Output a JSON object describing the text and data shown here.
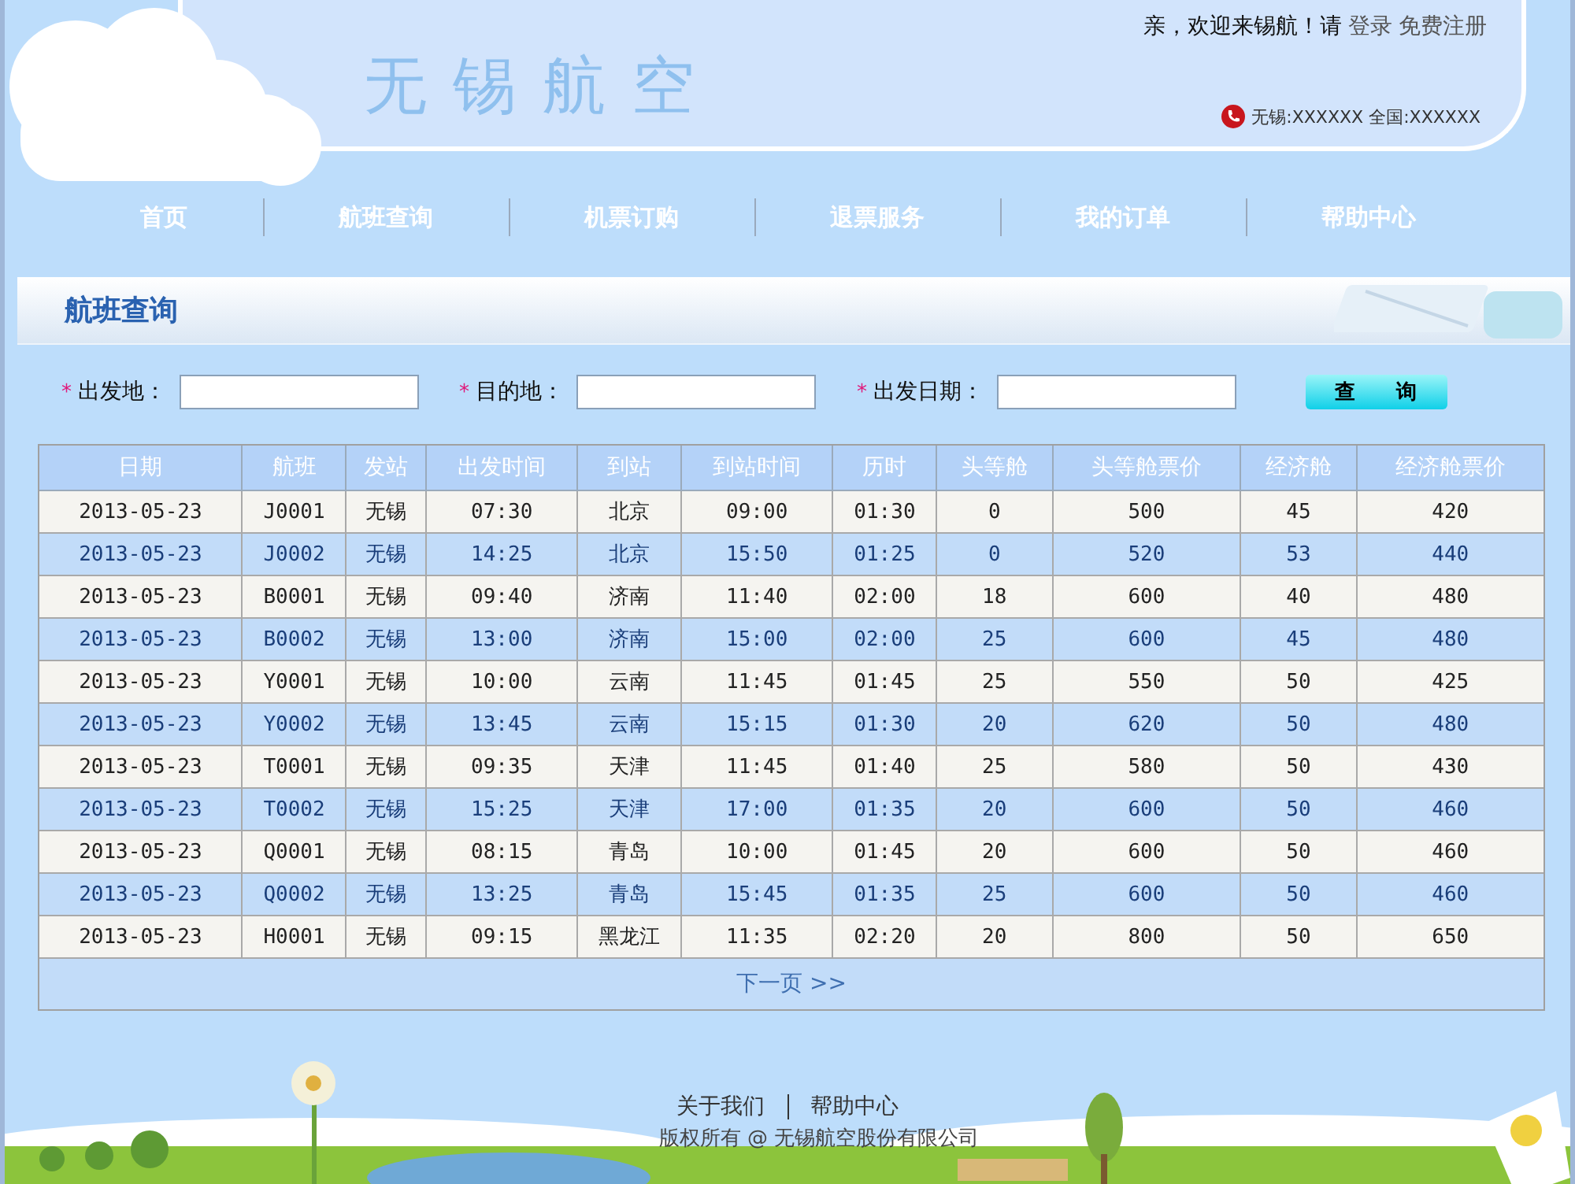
{
  "header": {
    "logo": "无 锡 航 空",
    "welcome": "亲，欢迎来锡航！请",
    "login": "登录",
    "register": "免费注册",
    "hotline": "无锡:XXXXXX 全国:XXXXXX"
  },
  "nav": [
    {
      "label": "首页"
    },
    {
      "label": "航班查询"
    },
    {
      "label": "机票订购"
    },
    {
      "label": "退票服务"
    },
    {
      "label": "我的订单"
    },
    {
      "label": "帮助中心"
    }
  ],
  "section_title": "航班查询",
  "search": {
    "fields": [
      {
        "mark": "*",
        "label": "出发地："
      },
      {
        "mark": "*",
        "label": "目的地："
      },
      {
        "mark": "*",
        "label": "出发日期："
      }
    ],
    "button": "查　　询"
  },
  "table": {
    "columns": [
      "日期",
      "航班",
      "发站",
      "出发时间",
      "到站",
      "到站时间",
      "历时",
      "头等舱",
      "头等舱票价",
      "经济舱",
      "经济舱票价"
    ],
    "rows": [
      [
        "2013-05-23",
        "J0001",
        "无锡",
        "07:30",
        "北京",
        "09:00",
        "01:30",
        "0",
        "500",
        "45",
        "420"
      ],
      [
        "2013-05-23",
        "J0002",
        "无锡",
        "14:25",
        "北京",
        "15:50",
        "01:25",
        "0",
        "520",
        "53",
        "440"
      ],
      [
        "2013-05-23",
        "B0001",
        "无锡",
        "09:40",
        "济南",
        "11:40",
        "02:00",
        "18",
        "600",
        "40",
        "480"
      ],
      [
        "2013-05-23",
        "B0002",
        "无锡",
        "13:00",
        "济南",
        "15:00",
        "02:00",
        "25",
        "600",
        "45",
        "480"
      ],
      [
        "2013-05-23",
        "Y0001",
        "无锡",
        "10:00",
        "云南",
        "11:45",
        "01:45",
        "25",
        "550",
        "50",
        "425"
      ],
      [
        "2013-05-23",
        "Y0002",
        "无锡",
        "13:45",
        "云南",
        "15:15",
        "01:30",
        "20",
        "620",
        "50",
        "480"
      ],
      [
        "2013-05-23",
        "T0001",
        "无锡",
        "09:35",
        "天津",
        "11:45",
        "01:40",
        "25",
        "580",
        "50",
        "430"
      ],
      [
        "2013-05-23",
        "T0002",
        "无锡",
        "15:25",
        "天津",
        "17:00",
        "01:35",
        "20",
        "600",
        "50",
        "460"
      ],
      [
        "2013-05-23",
        "Q0001",
        "无锡",
        "08:15",
        "青岛",
        "10:00",
        "01:45",
        "20",
        "600",
        "50",
        "460"
      ],
      [
        "2013-05-23",
        "Q0002",
        "无锡",
        "13:25",
        "青岛",
        "15:45",
        "01:35",
        "25",
        "600",
        "50",
        "460"
      ],
      [
        "2013-05-23",
        "H0001",
        "无锡",
        "09:15",
        "黑龙江",
        "11:35",
        "02:20",
        "20",
        "800",
        "50",
        "650"
      ]
    ],
    "next_page": "下一页 >>"
  },
  "footer": {
    "links": [
      "关于我们",
      "帮助中心"
    ],
    "copyright": "版权所有 @ 无锡航空股份有限公司"
  }
}
